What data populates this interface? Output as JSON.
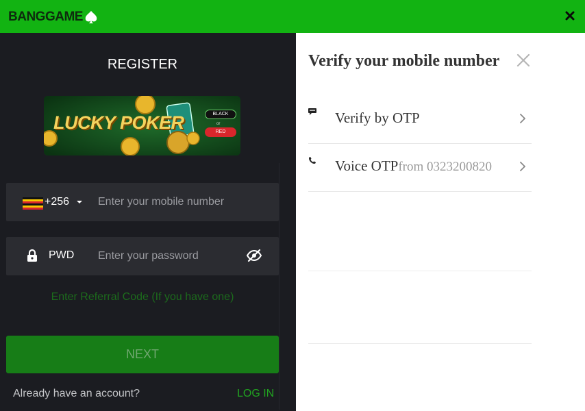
{
  "header": {
    "logo_text": "BANGGAME",
    "brand_color": "#12b312"
  },
  "register": {
    "title": "REGISTER",
    "banner": {
      "text": "LUCKY POKER",
      "button_black": "BLACK",
      "button_or": "or",
      "button_red": "RED"
    },
    "phone": {
      "country_code": "+256",
      "placeholder": "Enter your mobile number"
    },
    "password": {
      "label": "PWD",
      "placeholder": "Enter your password"
    },
    "referral_link": "Enter Referral Code (If you have one)",
    "next_button": "NEXT",
    "already_text": "Already have an account?",
    "login_link": "LOG IN"
  },
  "verify": {
    "title": "Verify your mobile number",
    "options": [
      {
        "label": "Verify by OTP",
        "sub": ""
      },
      {
        "label": "Voice OTP",
        "sub": "from 0323200820"
      }
    ]
  }
}
